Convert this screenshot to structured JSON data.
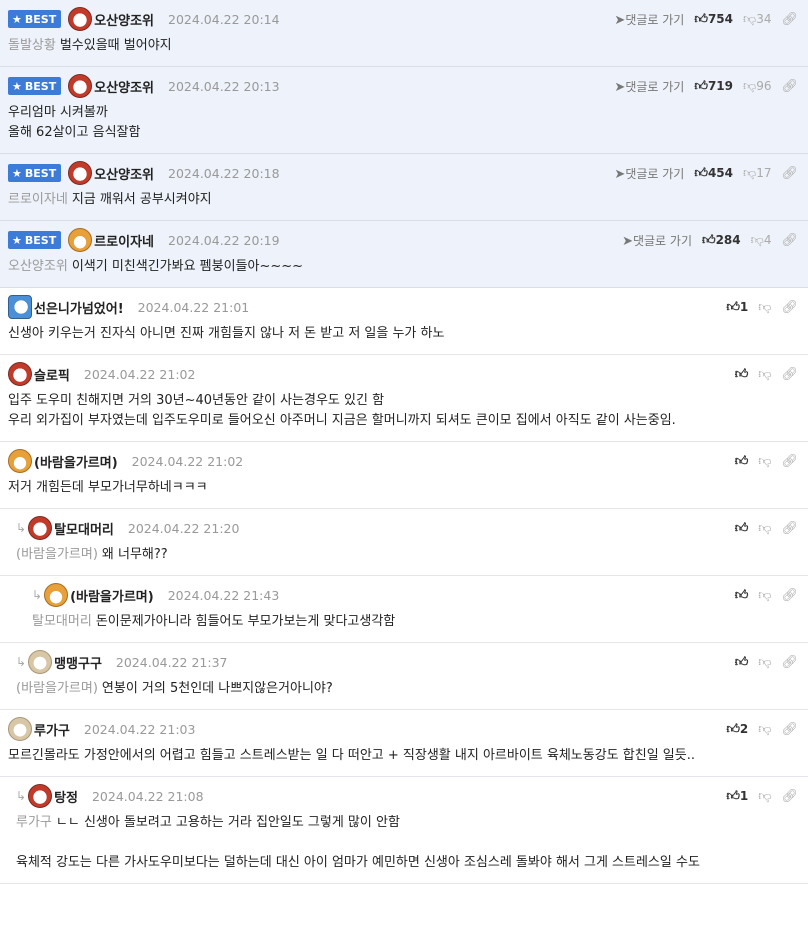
{
  "best_label": "BEST",
  "goto_label": "댓글로 가기",
  "best_comments": [
    {
      "nick": "오산양조위",
      "date": "2024.04.22 20:14",
      "up": "754",
      "down": "34",
      "tag": "돌발상황",
      "lines": [
        "벌수있을때 벌어야지"
      ],
      "avatar": "red"
    },
    {
      "nick": "오산양조위",
      "date": "2024.04.22 20:13",
      "up": "719",
      "down": "96",
      "tag": "",
      "lines": [
        "우리엄마 시켜볼까",
        "올해 62살이고 음식잘함"
      ],
      "avatar": "red"
    },
    {
      "nick": "오산양조위",
      "date": "2024.04.22 20:18",
      "up": "454",
      "down": "17",
      "tag": "르로이자네",
      "lines": [
        "지금 깨워서 공부시켜야지"
      ],
      "avatar": "red"
    },
    {
      "nick": "르로이자네",
      "date": "2024.04.22 20:19",
      "up": "284",
      "down": "4",
      "tag": "오산양조위",
      "lines": [
        "이색기 미친색긴가봐요 펨붕이들아~~~~"
      ],
      "avatar": "fox"
    }
  ],
  "comments": [
    {
      "nick": "선은니가넘었어!",
      "date": "2024.04.22 21:01",
      "up": "1",
      "tag": "",
      "lines": [
        "신생아 키우는거 진자식 아니면 진짜 개힘들지 않나 저 돈 받고 저 일을 누가 하노"
      ],
      "avatar": "blue",
      "level": 0
    },
    {
      "nick": "슬로픽",
      "date": "2024.04.22 21:02",
      "up": "",
      "tag": "",
      "lines": [
        "입주 도우미 친해지면 거의 30년~40년동안 같이 사는경우도 있긴 함",
        "우리 외가집이 부자였는데 입주도우미로 들어오신 아주머니 지금은 할머니까지 되셔도 큰이모 집에서 아직도 같이 사는중임."
      ],
      "avatar": "red",
      "level": 0
    },
    {
      "nick": "(바람을가르며)",
      "date": "2024.04.22 21:02",
      "up": "",
      "tag": "",
      "lines": [
        "저거 개힘든데 부모가너무하네ㅋㅋㅋ"
      ],
      "avatar": "fox",
      "level": 0
    },
    {
      "nick": "탈모대머리",
      "date": "2024.04.22 21:20",
      "up": "",
      "tag": "(바람을가르며)",
      "lines": [
        "왜 너무해??"
      ],
      "avatar": "red",
      "level": 1
    },
    {
      "nick": "(바람을가르며)",
      "date": "2024.04.22 21:43",
      "up": "",
      "tag": "탈모대머리",
      "lines": [
        "돈이문제가아니라 힘들어도 부모가보는게 맞다고생각함"
      ],
      "avatar": "fox",
      "level": 2
    },
    {
      "nick": "맹맹구구",
      "date": "2024.04.22 21:37",
      "up": "",
      "tag": "(바람을가르며)",
      "lines": [
        "연봉이 거의 5천인데 나쁘지않은거아니야?"
      ],
      "avatar": "dog",
      "level": 1
    },
    {
      "nick": "루가구",
      "date": "2024.04.22 21:03",
      "up": "2",
      "tag": "",
      "lines": [
        "모르긴몰라도 가정안에서의 어렵고 힘들고 스트레스받는 일 다 떠안고 + 직장생활 내지 아르바이트 육체노동강도 합친일 일듯.."
      ],
      "avatar": "dog",
      "level": 0
    },
    {
      "nick": "탕정",
      "date": "2024.04.22 21:08",
      "up": "1",
      "tag": "루가구",
      "lines": [
        "ㄴㄴ 신생아 돌보려고 고용하는 거라 집안일도 그렇게 많이 안함",
        "",
        "육체적 강도는 다른 가사도우미보다는 덜하는데 대신 아이 엄마가 예민하면 신생아 조심스레 돌봐야 해서 그게 스트레스일 수도"
      ],
      "avatar": "red",
      "level": 1
    }
  ],
  "colors": {
    "best_bg": "#eef2fa",
    "badge": "#3d7bd9"
  },
  "icons": {
    "thumb_up": "thumbs-up-icon",
    "thumb_down": "thumbs-down-icon",
    "link": "link-icon",
    "goto": "send-arrow-icon"
  }
}
